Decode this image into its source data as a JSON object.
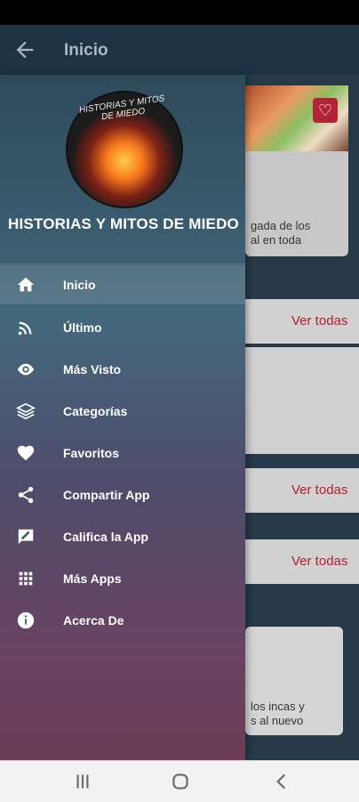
{
  "appbar": {
    "title": "Inicio"
  },
  "drawer": {
    "app_name": "HISTORIAS Y MITOS DE MIEDO",
    "logo_text": "HISTORIAS Y MITOS DE MIEDO",
    "items": [
      {
        "label": "Inicio",
        "icon": "home-icon"
      },
      {
        "label": "Último",
        "icon": "rss-icon"
      },
      {
        "label": "Más Visto",
        "icon": "eye-icon"
      },
      {
        "label": "Categorías",
        "icon": "layers-icon"
      },
      {
        "label": "Favoritos",
        "icon": "heart-icon"
      },
      {
        "label": "Compartir App",
        "icon": "share-icon"
      },
      {
        "label": "Califica la App",
        "icon": "rate-icon"
      },
      {
        "label": "Más Apps",
        "icon": "grid-icon"
      },
      {
        "label": "Acerca De",
        "icon": "info-icon"
      }
    ]
  },
  "background": {
    "snippet_line1": "gada de los",
    "snippet_line2": "al en toda",
    "ver_todas_1": "Ver todas",
    "ver_todas_2": "Ver todas",
    "ver_todas_3": "Ver todas",
    "mini_line1": "los incas y",
    "mini_line2": "s al nuevo"
  }
}
